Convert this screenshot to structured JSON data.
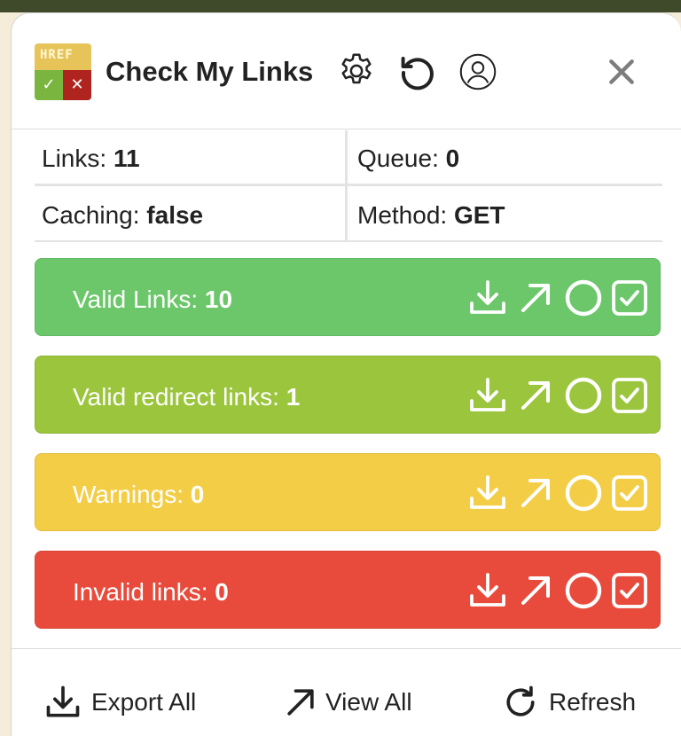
{
  "header": {
    "title": "Check My Links",
    "logo_text": "HREF",
    "icons": [
      "gear-icon",
      "refresh-icon",
      "user-icon",
      "close-icon"
    ]
  },
  "stats": {
    "links_label": "Links:",
    "links_value": "11",
    "queue_label": "Queue:",
    "queue_value": "0",
    "caching_label": "Caching:",
    "caching_value": "false",
    "method_label": "Method:",
    "method_value": "GET"
  },
  "categories": [
    {
      "label": "Valid Links:",
      "count": "10",
      "color": "#6cc76a"
    },
    {
      "label": "Valid redirect links:",
      "count": "1",
      "color": "#9bc53d"
    },
    {
      "label": "Warnings:",
      "count": "0",
      "color": "#f4cd47"
    },
    {
      "label": "Invalid links:",
      "count": "0",
      "color": "#e84b3c"
    }
  ],
  "footer": {
    "export_label": "Export All",
    "view_label": "View All",
    "refresh_label": "Refresh"
  }
}
